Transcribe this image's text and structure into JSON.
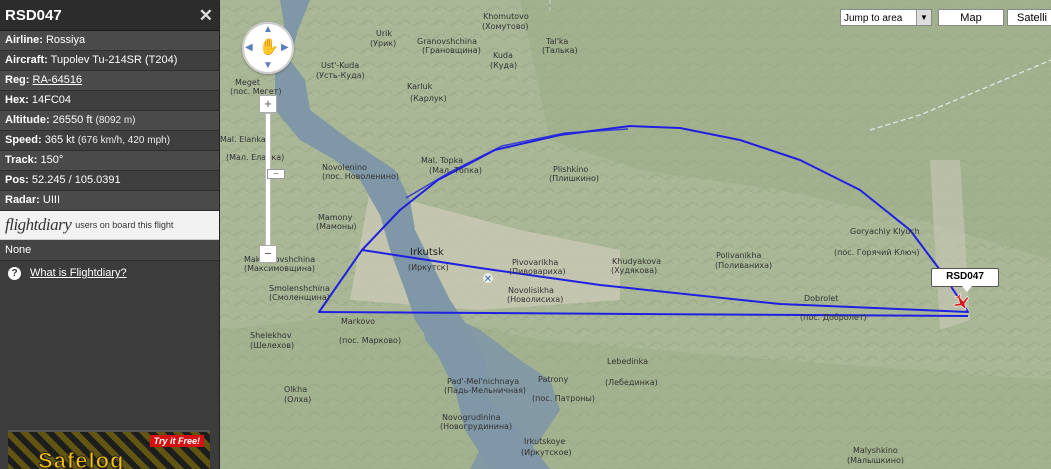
{
  "panel": {
    "title": "RSD047",
    "close": "✕",
    "rows": [
      {
        "label": "Airline:",
        "value": "Rossiya",
        "extra": ""
      },
      {
        "label": "Aircraft:",
        "value": "Tupolev Tu-214SR (T204)",
        "extra": ""
      },
      {
        "label": "Reg:",
        "value": "RA-64516",
        "extra": ""
      },
      {
        "label": "Hex:",
        "value": "14FC04",
        "extra": ""
      },
      {
        "label": "Altitude:",
        "value": "26550 ft",
        "extra": "(8092 m)"
      },
      {
        "label": "Speed:",
        "value": "365 kt",
        "extra": "(676 km/h, 420 mph)"
      },
      {
        "label": "Track:",
        "value": "150°",
        "extra": ""
      },
      {
        "label": "Pos:",
        "value": "52.245 / 105.0391",
        "extra": ""
      },
      {
        "label": "Radar:",
        "value": "UIII",
        "extra": ""
      }
    ],
    "flightdiary": {
      "logo": "flightdiary",
      "sub": "users on board this flight"
    },
    "none": "None",
    "what_link": "What is Flightdiary?",
    "ad": {
      "brand": "Safelog",
      "try": "Try it Free!"
    }
  },
  "map_ui": {
    "jump_to": "Jump to area",
    "map_button": "Map",
    "satellite_button": "Satelli",
    "flight_tag": "RSD047"
  },
  "places": [
    {
      "en": "Khomutovo",
      "ru": "(Хомутово)"
    },
    {
      "en": "Urik",
      "ru": "(Урик)"
    },
    {
      "en": "Granovshchina",
      "ru": "(Грановщина)"
    },
    {
      "en": "Kuda",
      "ru": "(Куда)"
    },
    {
      "en": "Tal'ka",
      "ru": "(Талька)"
    },
    {
      "en": "Ust'-Kuda",
      "ru": "(Усть-Куда)"
    },
    {
      "en": "Meget",
      "ru": "(пос. Мегет)"
    },
    {
      "en": "Karluk",
      "ru": "(Карлук)"
    },
    {
      "en": "Mal. Elanka",
      "ru": "(Мал. Еланка)"
    },
    {
      "en": "Novolenino",
      "ru": "(пос. Новоленино)"
    },
    {
      "en": "Mal. Topka",
      "ru": "(Мал. Топка)"
    },
    {
      "en": "Plishkino",
      "ru": "(Плишкино)"
    },
    {
      "en": "Mamony",
      "ru": "(Мамоны)"
    },
    {
      "en": "Irkutsk",
      "ru": "(Иркутск)"
    },
    {
      "en": "Pivovarikha",
      "ru": "(Пивовариха)"
    },
    {
      "en": "Khudyakova",
      "ru": "(Худякова)"
    },
    {
      "en": "Polivanikha",
      "ru": "(Поливаниха)"
    },
    {
      "en": "Goryachiy Klyuch",
      "ru": "(пос. Горячий Ключ)"
    },
    {
      "en": "Maksimovshchina",
      "ru": "(Максимовщина)"
    },
    {
      "en": "Novolisikha",
      "ru": "(Новолисиха)"
    },
    {
      "en": "Smolenshchina",
      "ru": "(Смоленщина)"
    },
    {
      "en": "Dobrolet",
      "ru": "(пос. Добролет)"
    },
    {
      "en": "Shelekhov",
      "ru": "(Шелехов)"
    },
    {
      "en": "Markovo",
      "ru": "(пос. Марково)"
    },
    {
      "en": "Olkha",
      "ru": "(Олха)"
    },
    {
      "en": "Pad'-Mel'nichnaya",
      "ru": "(Падь-Мельничная)"
    },
    {
      "en": "Patrony",
      "ru": "(пос. Патроны)"
    },
    {
      "en": "Lebedinka",
      "ru": "(Лебединка)"
    },
    {
      "en": "Novogrudinina",
      "ru": "(Новогрудинина)"
    },
    {
      "en": "Irkutskoye",
      "ru": "(Иркутское)"
    },
    {
      "en": "Malyshkino",
      "ru": "(Малышкино)"
    }
  ],
  "colors": {
    "track": "#2020e0",
    "terrain": "#a9b796",
    "water": "#7f97a6",
    "city": "#c9c8b5"
  }
}
